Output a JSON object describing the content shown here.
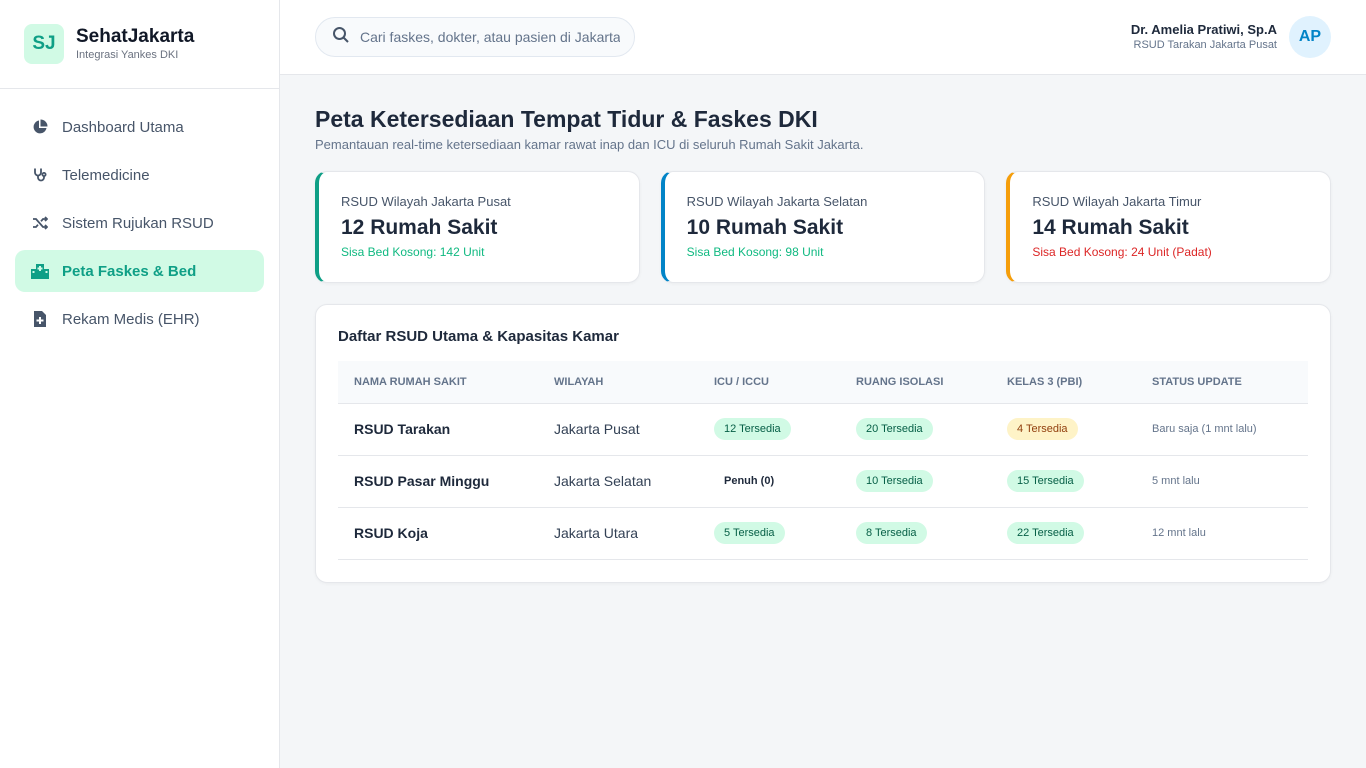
{
  "brand": {
    "logo": "SJ",
    "name": "SehatJakarta",
    "subtitle": "Integrasi Yankes DKI"
  },
  "nav": [
    {
      "label": "Dashboard Utama",
      "icon": "pie-chart-icon",
      "active": false
    },
    {
      "label": "Telemedicine",
      "icon": "stethoscope-icon",
      "active": false
    },
    {
      "label": "Sistem Rujukan RSUD",
      "icon": "shuffle-icon",
      "active": false
    },
    {
      "label": "Peta Faskes & Bed",
      "icon": "hospital-icon",
      "active": true
    },
    {
      "label": "Rekam Medis (EHR)",
      "icon": "medical-file-icon",
      "active": false
    }
  ],
  "search": {
    "placeholder": "Cari faskes, dokter, atau pasien di Jakarta..."
  },
  "user": {
    "name": "Dr. Amelia Pratiwi, Sp.A",
    "role": "RSUD Tarakan Jakarta Pusat",
    "initials": "AP"
  },
  "page": {
    "title": "Peta Ketersediaan Tempat Tidur & Faskes DKI",
    "subtitle": "Pemantauan real-time ketersediaan kamar rawat inap dan ICU di seluruh Rumah Sakit Jakarta."
  },
  "cards": [
    {
      "label": "RSUD Wilayah Jakarta Pusat",
      "value": "12 Rumah Sakit",
      "note": "Sisa Bed Kosong: 142 Unit",
      "accent": "#0f9f86",
      "note_color": "#10b981"
    },
    {
      "label": "RSUD Wilayah Jakarta Selatan",
      "value": "10 Rumah Sakit",
      "note": "Sisa Bed Kosong: 98 Unit",
      "accent": "#0284c7",
      "note_color": "#10b981"
    },
    {
      "label": "RSUD Wilayah Jakarta Timur",
      "value": "14 Rumah Sakit",
      "note": "Sisa Bed Kosong: 24 Unit (Padat)",
      "accent": "#f59e0b",
      "note_color": "#dc2626"
    }
  ],
  "table": {
    "title": "Daftar RSUD Utama & Kapasitas Kamar",
    "headers": [
      "Nama Rumah Sakit",
      "Wilayah",
      "ICU / ICCU",
      "Ruang Isolasi",
      "Kelas 3 (PBI)",
      "Status Update"
    ],
    "rows": [
      {
        "name": "RSUD Tarakan",
        "region": "Jakarta Pusat",
        "icu": "12 Tersedia",
        "icu_status": "ok",
        "isolation": "20 Tersedia",
        "isolation_status": "ok",
        "class3": "4 Tersedia",
        "class3_status": "warn",
        "updated": "Baru saja (1 mnt lalu)"
      },
      {
        "name": "RSUD Pasar Minggu",
        "region": "Jakarta Selatan",
        "icu": "Penuh (0)",
        "icu_status": "full",
        "isolation": "10 Tersedia",
        "isolation_status": "ok",
        "class3": "15 Tersedia",
        "class3_status": "ok",
        "updated": "5 mnt lalu"
      },
      {
        "name": "RSUD Koja",
        "region": "Jakarta Utara",
        "icu": "5 Tersedia",
        "icu_status": "ok",
        "isolation": "8 Tersedia",
        "isolation_status": "ok",
        "class3": "22 Tersedia",
        "class3_status": "ok",
        "updated": "12 mnt lalu"
      }
    ]
  }
}
